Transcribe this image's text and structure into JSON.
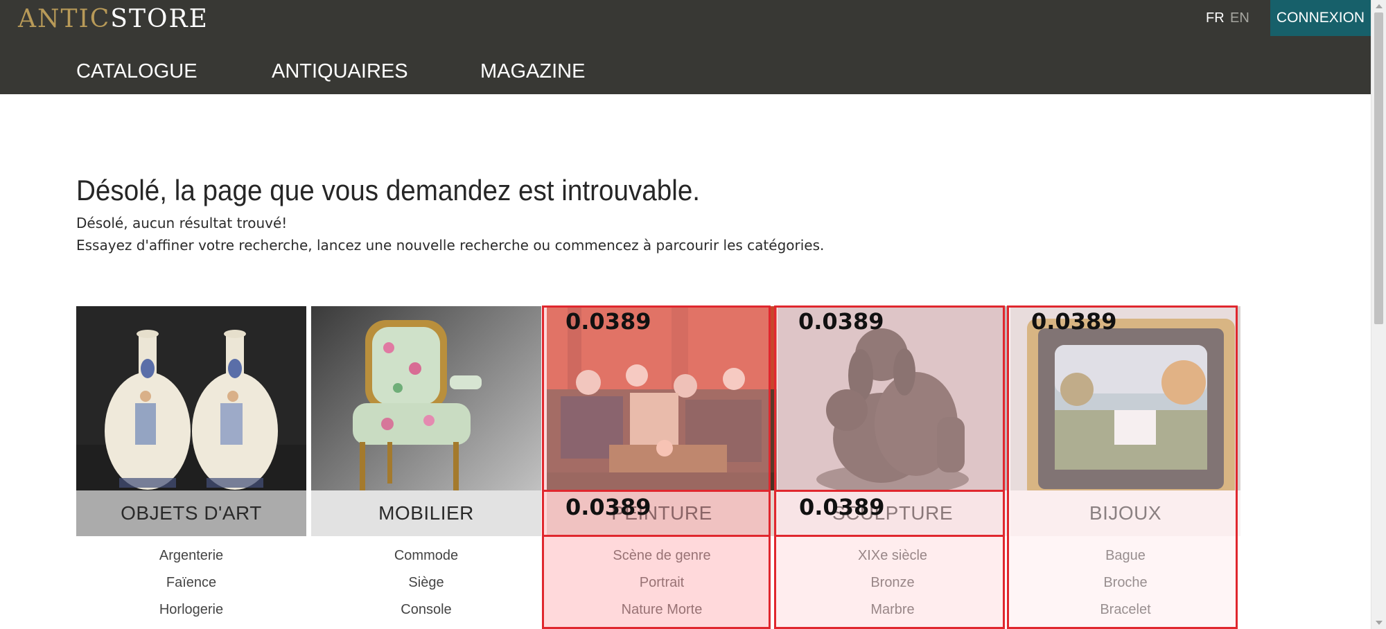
{
  "header": {
    "logo_part1": "ANTIC",
    "logo_part2": "STORE",
    "lang_fr": "FR",
    "lang_en": "EN",
    "login_label": "CONNEXION",
    "nav": [
      "CATALOGUE",
      "ANTIQUAIRES",
      "MAGAZINE"
    ],
    "background_color": "#383834",
    "accent_color": "#17606a",
    "logo_gold": "#b89a58"
  },
  "main": {
    "title": "Désolé, la page que vous demandez est introuvable.",
    "message1": "Désolé, aucun résultat trouvé!",
    "message2": "Essayez d'affiner votre recherche, lancez une nouvelle recherche ou commencez à parcourir les catégories."
  },
  "categories": [
    {
      "label": "OBJETS D'ART",
      "image": "faience-vases-image",
      "items": [
        "Argenterie",
        "Faïence",
        "Horlogerie"
      ]
    },
    {
      "label": "MOBILIER",
      "image": "armchair-image",
      "items": [
        "Commode",
        "Siège",
        "Console"
      ]
    },
    {
      "label": "PEINTURE",
      "image": "genre-painting-image",
      "items": [
        "Scène de genre",
        "Portrait",
        "Nature Morte"
      ]
    },
    {
      "label": "SCULPTURE",
      "image": "bronze-dogs-image",
      "items": [
        "XIXe siècle",
        "Bronze",
        "Marbre"
      ]
    },
    {
      "label": "BIJOUX",
      "image": "framed-micromosaic-image",
      "items": [
        "Bague",
        "Broche",
        "Bracelet"
      ]
    }
  ],
  "annotations": {
    "scores": [
      "0.0389",
      "0.0389",
      "0.0389",
      "0.0389",
      "0.0389"
    ],
    "color": "#e0272e"
  }
}
